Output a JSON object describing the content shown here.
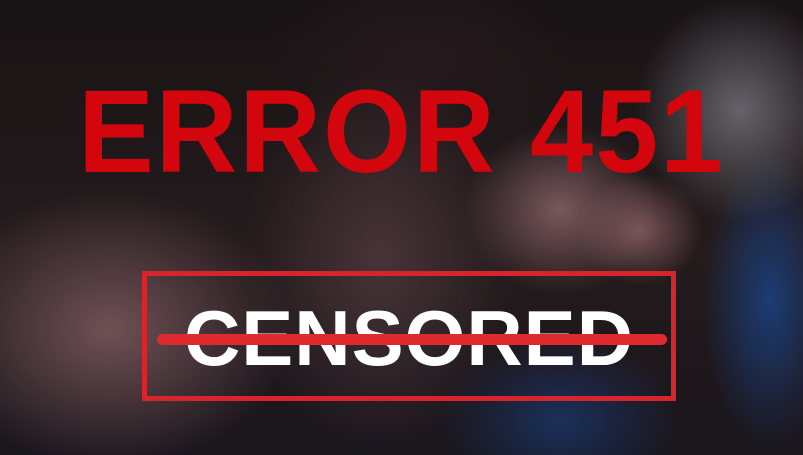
{
  "headline": "ERROR 451",
  "stamp": {
    "text": "CENSORED"
  },
  "colors": {
    "headline": "#d3050d",
    "stamp_border": "#d7252b",
    "strike": "#df2a30",
    "stamp_text": "#ffffff"
  }
}
